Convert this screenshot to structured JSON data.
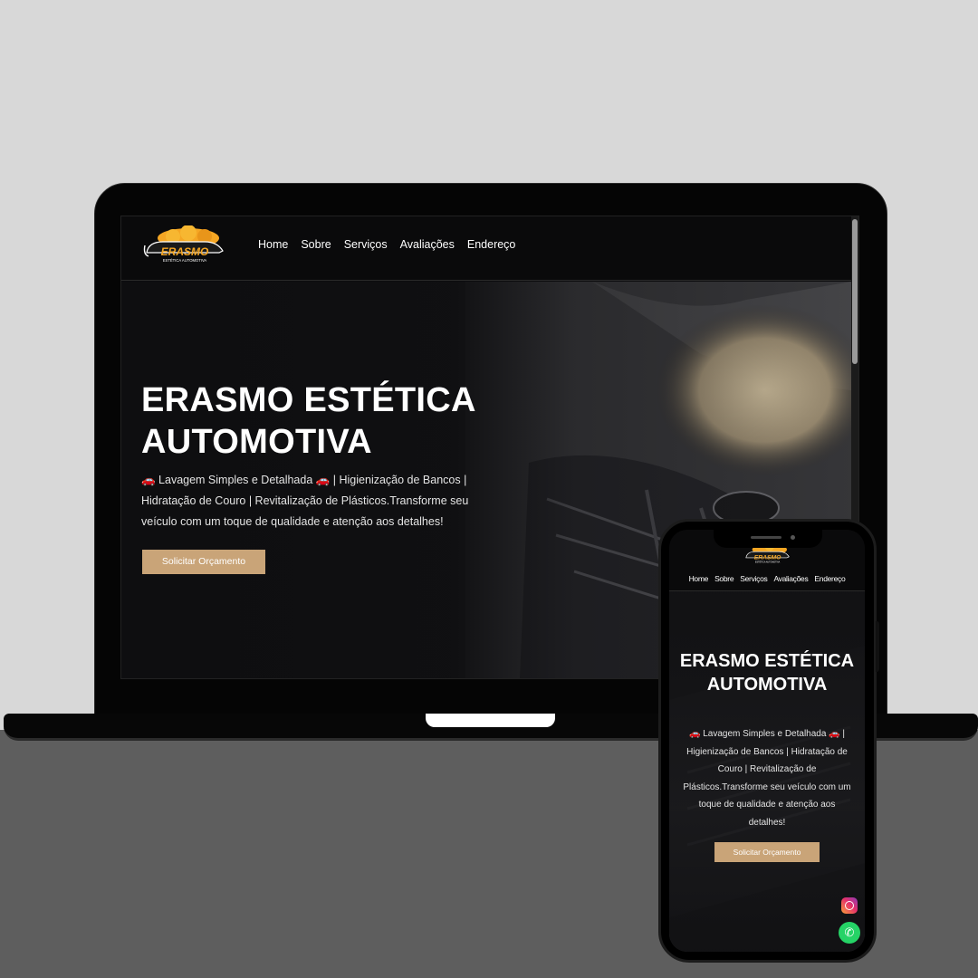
{
  "desktop": {
    "logo": {
      "brand": "ERASMO",
      "tagline": "ESTÉTICA AUTOMOTIVA"
    },
    "nav": [
      {
        "label": "Home"
      },
      {
        "label": "Sobre"
      },
      {
        "label": "Serviços"
      },
      {
        "label": "Avaliações"
      },
      {
        "label": "Endereço"
      }
    ],
    "hero": {
      "title": "ERASMO ESTÉTICA AUTOMOTIVA",
      "description": "🚗 Lavagem Simples e Detalhada 🚗 | Higienização de Bancos | Hidratação de Couro | Revitalização de Plásticos.Transforme seu veículo com um toque de qualidade e atenção aos detalhes!",
      "cta_label": "Solicitar Orçamento"
    }
  },
  "mobile": {
    "logo": {
      "brand": "ERASMO",
      "tagline": "ESTÉTICA AUTOMOTIVA"
    },
    "nav": [
      {
        "label": "Home"
      },
      {
        "label": "Sobre"
      },
      {
        "label": "Serviços"
      },
      {
        "label": "Avaliações"
      },
      {
        "label": "Endereço"
      }
    ],
    "hero": {
      "title": "ERASMO ESTÉTICA AUTOMOTIVA",
      "description": "🚗 Lavagem Simples e Detalhada 🚗 | Higienização de Bancos | Hidratação de Couro | Revitalização de Plásticos.Transforme seu veículo com um toque de qualidade e atenção aos detalhes!",
      "cta_label": "Solicitar Orçamento"
    },
    "floating": {
      "instagram_icon": "instagram-icon",
      "whatsapp_icon": "whatsapp-icon"
    }
  },
  "colors": {
    "accent": "#c9a478",
    "logo_orange": "#f5a623",
    "background": "#0c0c0e",
    "whatsapp": "#25d366"
  }
}
